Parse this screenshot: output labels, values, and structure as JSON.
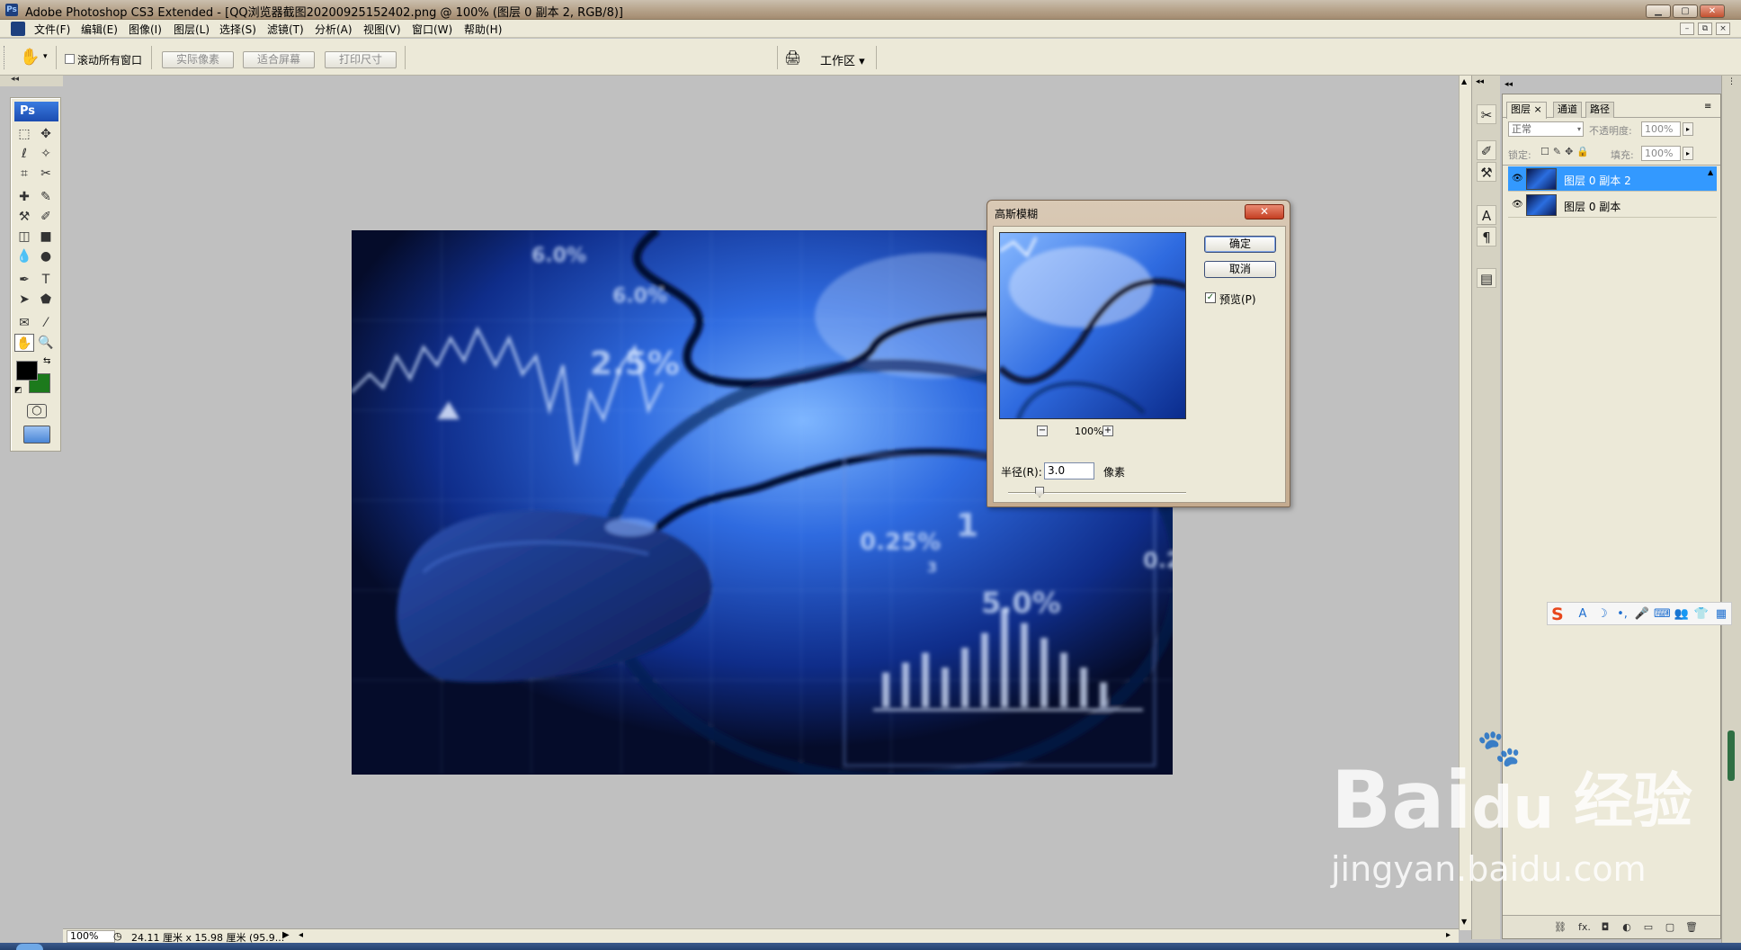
{
  "window": {
    "app_logo": "Ps",
    "title": "Adobe Photoshop CS3 Extended - [QQ浏览器截图20200925152402.png @ 100% (图层 0 副本 2, RGB/8)]",
    "controls": [
      "▁",
      "▢",
      "✕"
    ],
    "doc_controls": [
      "–",
      "⧉",
      "×"
    ]
  },
  "menu": {
    "items": [
      "文件(F)",
      "编辑(E)",
      "图像(I)",
      "图层(L)",
      "选择(S)",
      "滤镜(T)",
      "分析(A)",
      "视图(V)",
      "窗口(W)",
      "帮助(H)"
    ]
  },
  "options": {
    "scroll_all_label": "滚动所有窗口",
    "actual_pixels": "实际像素",
    "fit_screen": "适合屏幕",
    "print_size": "打印尺寸",
    "workspace": "工作区 ▾"
  },
  "toolbox": {
    "badge": "Ps",
    "icons": [
      "marquee-icon",
      "move-icon",
      "lasso-icon",
      "magic-wand-icon",
      "crop-icon",
      "slice-icon",
      "healing-brush-icon",
      "brush-icon",
      "clone-stamp-icon",
      "history-brush-icon",
      "eraser-icon",
      "gradient-icon",
      "blur-icon",
      "dodge-icon",
      "pen-icon",
      "type-icon",
      "path-selection-icon",
      "shape-icon",
      "notes-icon",
      "eyedropper-icon",
      "hand-icon",
      "zoom-icon"
    ],
    "glyphs": [
      "⬚",
      "✥",
      "ℓ",
      "✧",
      "⌗",
      "✂",
      "✚",
      "✎",
      "⚒",
      "✐",
      "◫",
      "■",
      "💧",
      "●",
      "✒",
      "T",
      "➤",
      "⬟",
      "✉",
      "⁄",
      "✋",
      "🔍"
    ],
    "fg_color": "#000000",
    "bg_color": "#1c7a1c"
  },
  "document": {
    "labels": [
      "6.0%",
      "6.0%",
      "2.5%",
      "0.25%",
      "1",
      "5.0%",
      "3",
      "0.2"
    ],
    "bars": [
      0.35,
      0.45,
      0.55,
      0.4,
      0.6,
      0.75,
      1.0,
      0.85,
      0.7,
      0.55,
      0.4,
      0.25
    ]
  },
  "status": {
    "zoom": "100%",
    "docinfo": "24.11 厘米 x 15.98 厘米 (95.9..."
  },
  "layers_panel": {
    "tabs": [
      "图层",
      "通道",
      "路径"
    ],
    "blend_mode": "正常",
    "opacity_label": "不透明度:",
    "opacity_value": "100%",
    "lock_label": "锁定:",
    "fill_label": "填充:",
    "fill_value": "100%",
    "layers": [
      {
        "name": "图层 0 副本 2",
        "selected": true
      },
      {
        "name": "图层 0 副本",
        "selected": false
      }
    ],
    "bottom_icons": [
      "⛓",
      "fx.",
      "◘",
      "◐",
      "▭",
      "▢",
      "🗑"
    ]
  },
  "dialog": {
    "title": "高斯模糊",
    "close": "✕",
    "ok": "确定",
    "cancel": "取消",
    "preview_label": "预览(P)",
    "preview_checked": true,
    "zoom_value": "100%",
    "zoom_out": "−",
    "zoom_in": "+",
    "radius_label": "半径(R):",
    "radius_value": "3.0",
    "unit": "像素"
  },
  "ime": {
    "logo": "S",
    "icons": [
      "A",
      "☽",
      "•,",
      "🎤",
      "⌨",
      "👥",
      "👕",
      "▦"
    ]
  },
  "watermark": {
    "brand": "Bai",
    "brand2": "du",
    "suffix": "经验",
    "url": "jingyan.baidu.com"
  }
}
